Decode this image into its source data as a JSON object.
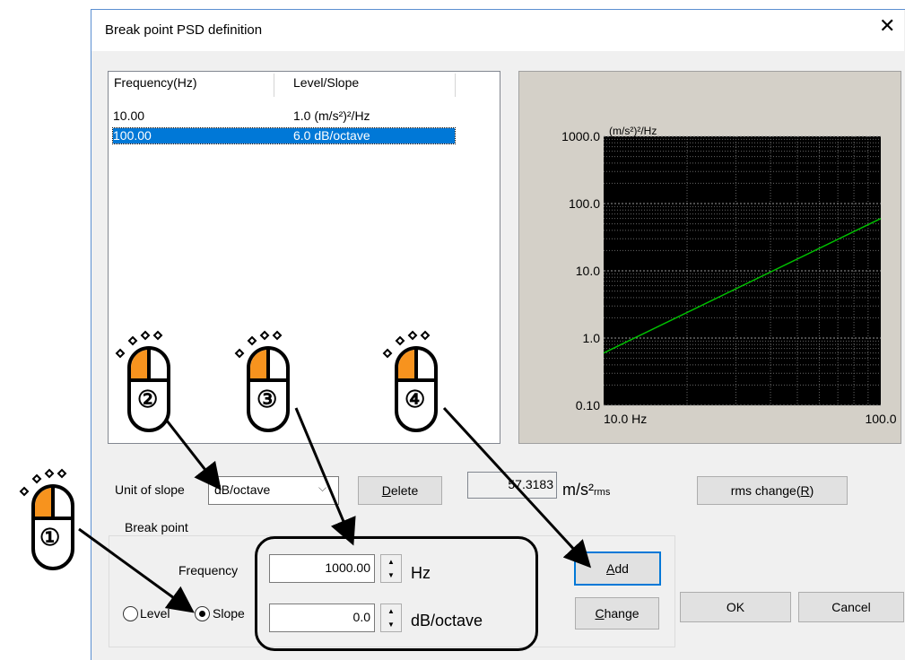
{
  "dialog": {
    "title": "Break point PSD definition",
    "close_symbol": "✕"
  },
  "table": {
    "headers": [
      "Frequency(Hz)",
      "Level/Slope"
    ],
    "rows": [
      {
        "frequency": "10.00",
        "level": "1.0 (m/s²)²/Hz",
        "selected": false
      },
      {
        "frequency": "100.00",
        "level": "6.0  dB/octave",
        "selected": true
      }
    ]
  },
  "chart_data": {
    "type": "line",
    "x_scale": "log",
    "y_scale": "log",
    "xlim": [
      10,
      100
    ],
    "ylim": [
      0.1,
      1000
    ],
    "x_ticks": [
      "10.0 Hz",
      "100.0"
    ],
    "y_ticks": [
      "1000.0",
      "100.0",
      "10.0",
      "1.0",
      "0.10"
    ],
    "y_unit": "(m/s²)²/Hz",
    "grid": true,
    "background": "#000000",
    "line_color": "#00c000",
    "series": [
      {
        "x": [
          10,
          100
        ],
        "y": [
          0.6,
          60
        ]
      }
    ]
  },
  "controls": {
    "unit_of_slope_label": "Unit of slope",
    "unit_of_slope_value": "dB/octave",
    "delete_label": "Delete",
    "delete_mnemonic": "D",
    "rms_value": "57.3183",
    "rms_unit": "m/s²",
    "rms_sub": "rms",
    "rms_change_label": "rms change(R)",
    "rms_change_mnemonic": "R"
  },
  "breakpoint": {
    "group_label": "Break point",
    "frequency_label": "Frequency",
    "frequency_value": "1000.00",
    "frequency_unit": "Hz",
    "slope_value": "0.0",
    "slope_unit": "dB/octave",
    "level_label": "Level",
    "slope_label": "Slope",
    "add_label": "Add",
    "change_label": "Change",
    "ok_label": "OK",
    "cancel_label": "Cancel"
  },
  "steps": [
    "①",
    "②",
    "③",
    "④"
  ],
  "colors": {
    "accent": "#0078d7",
    "mouse_button": "#f7931e"
  }
}
